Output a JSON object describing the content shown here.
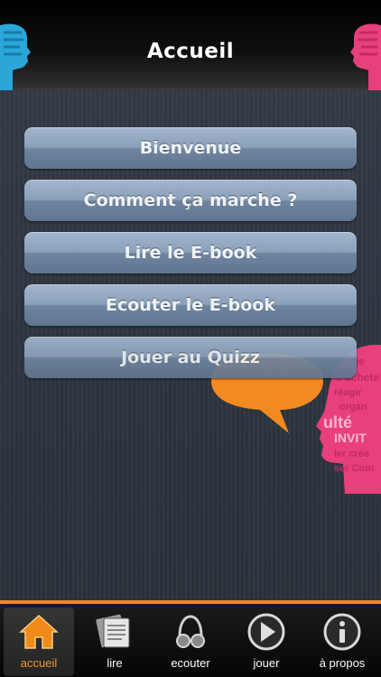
{
  "header": {
    "title": "Accueil"
  },
  "menu": [
    {
      "label": "Bienvenue"
    },
    {
      "label": "Comment ça marche ?"
    },
    {
      "label": "Lire le E-book"
    },
    {
      "label": "Ecouter le E-book"
    },
    {
      "label": "Jouer au Quizz"
    }
  ],
  "tabs": [
    {
      "label": "accueil",
      "icon": "home-icon",
      "active": true
    },
    {
      "label": "lire",
      "icon": "book-icon",
      "active": false
    },
    {
      "label": "ecouter",
      "icon": "headphones-icon",
      "active": false
    },
    {
      "label": "jouer",
      "icon": "play-icon",
      "active": false
    },
    {
      "label": "à propos",
      "icon": "info-icon",
      "active": false
    }
  ],
  "colors": {
    "accent": "#f08a1a",
    "button": "#8aa0b9",
    "background": "#2c323b",
    "speech_bubble": "#f28a22",
    "head_pink": "#e8407d",
    "head_blue": "#2aa6d8"
  }
}
